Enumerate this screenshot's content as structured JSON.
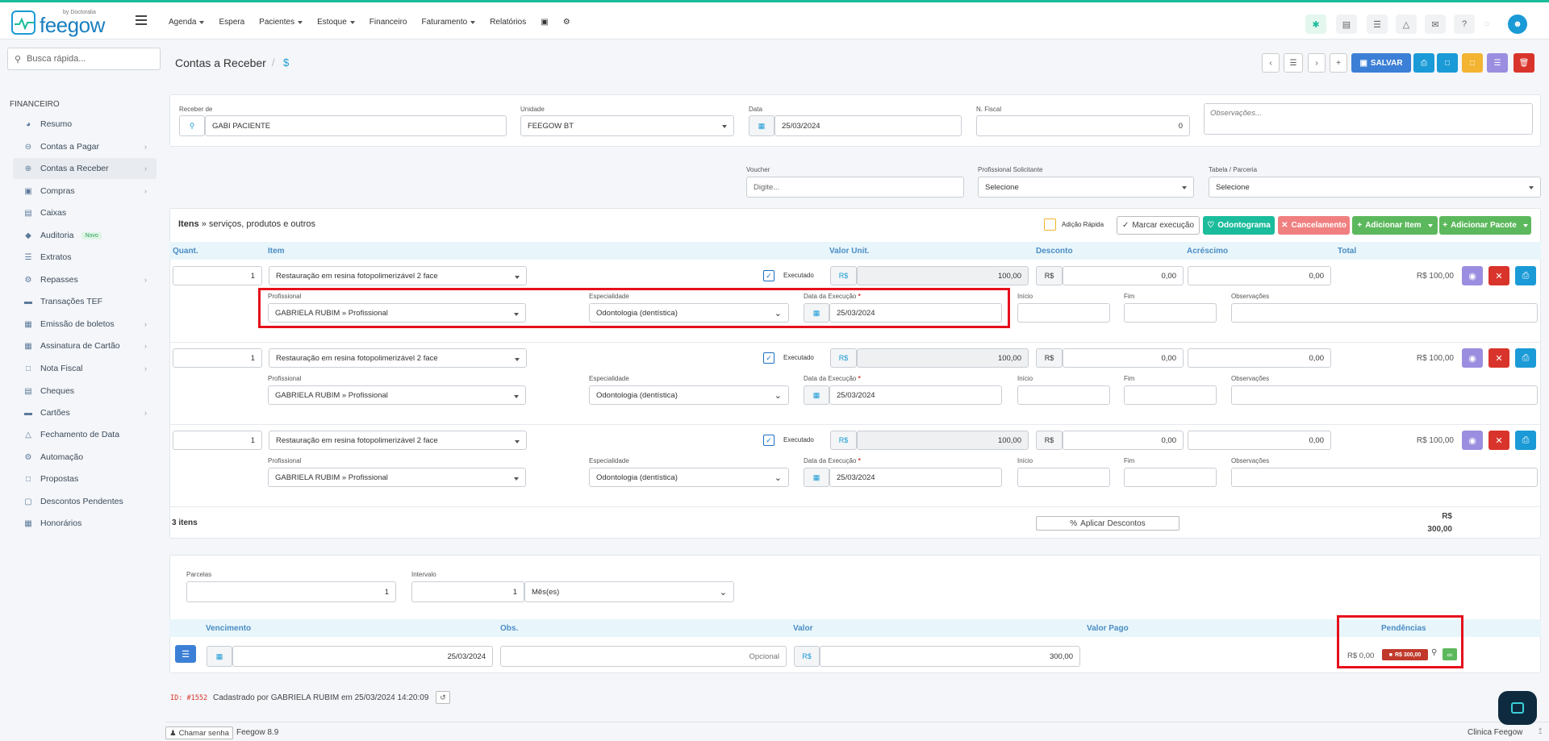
{
  "app": {
    "brand": "feegow",
    "brand_sub": "by Doctoralia"
  },
  "topnav": {
    "items": [
      {
        "label": "Agenda",
        "dropdown": true
      },
      {
        "label": "Espera",
        "dropdown": false
      },
      {
        "label": "Pacientes",
        "dropdown": true
      },
      {
        "label": "Estoque",
        "dropdown": true
      },
      {
        "label": "Financeiro",
        "dropdown": false
      },
      {
        "label": "Faturamento",
        "dropdown": true
      },
      {
        "label": "Relatórios",
        "dropdown": false
      }
    ]
  },
  "sidebar": {
    "search_placeholder": "Busca rápida...",
    "section_title": "FINANCEIRO",
    "new_badge": "Novo",
    "items": [
      {
        "label": "Resumo",
        "icon": "chart-icon"
      },
      {
        "label": "Contas a Pagar",
        "icon": "minus-circle-icon"
      },
      {
        "label": "Contas a Receber",
        "icon": "plus-circle-icon"
      },
      {
        "label": "Compras",
        "icon": "cart-icon"
      },
      {
        "label": "Caixas",
        "icon": "inbox-icon"
      },
      {
        "label": "Auditoria",
        "icon": "shield-icon"
      },
      {
        "label": "Extratos",
        "icon": "list-icon"
      },
      {
        "label": "Repasses",
        "icon": "handshake-icon"
      },
      {
        "label": "Transações TEF",
        "icon": "credit-card-icon"
      },
      {
        "label": "Emissão de boletos",
        "icon": "barcode-icon"
      },
      {
        "label": "Assinatura de Cartão",
        "icon": "card-signature-icon"
      },
      {
        "label": "Nota Fiscal",
        "icon": "document-icon"
      },
      {
        "label": "Cheques",
        "icon": "cheque-icon"
      },
      {
        "label": "Cartões",
        "icon": "credit-card-icon"
      },
      {
        "label": "Fechamento de Data",
        "icon": "lock-icon"
      },
      {
        "label": "Automação",
        "icon": "robot-icon"
      },
      {
        "label": "Propostas",
        "icon": "file-icon"
      },
      {
        "label": "Descontos Pendentes",
        "icon": "discount-icon"
      },
      {
        "label": "Honorários",
        "icon": "calendar-icon"
      }
    ]
  },
  "page": {
    "title": "Contas a Receber",
    "sep": "/",
    "currency_icon": "$",
    "save_label": "SALVAR"
  },
  "header_form": {
    "receber_de_label": "Receber de",
    "receber_de_value": "GABI PACIENTE",
    "unidade_label": "Unidade",
    "unidade_value": "FEEGOW BT",
    "data_label": "Data",
    "data_value": "25/03/2024",
    "nfiscal_label": "N. Fiscal",
    "nfiscal_value": "0",
    "obs_placeholder": "Observações...",
    "voucher_label": "Voucher",
    "voucher_placeholder": "Digite...",
    "prof_sol_label": "Profissional Solicitante",
    "prof_sol_value": "Selecione",
    "tabela_label": "Tabela / Parceria",
    "tabela_value": "Selecione"
  },
  "items_section": {
    "title_bold": "Itens",
    "title_rest": " » serviços, produtos e outros",
    "adicao_rapida": "Adição Rápida",
    "buttons": {
      "marcar": "Marcar execução",
      "odontograma": "Odontograma",
      "cancelamento": "Cancelamento",
      "add_item": "Adicionar Item",
      "add_pacote": "Adicionar Pacote"
    },
    "columns": {
      "quant": "Quant.",
      "item": "Item",
      "valor_unit": "Valor Unit.",
      "desconto": "Desconto",
      "acrescimo": "Acréscimo",
      "total": "Total"
    },
    "sub_labels": {
      "profissional": "Profissional",
      "especialidade": "Especialidade",
      "data_execucao": "Data da Execução",
      "required": "*",
      "inicio": "Início",
      "fim": "Fim",
      "observacoes": "Observações"
    },
    "executado_label": "Executado",
    "currency": "R$",
    "rows": [
      {
        "quant": "1",
        "item": "Restauração em resina fotopolimerizável 2 face",
        "executado": true,
        "valor_unit": "100,00",
        "desconto": "0,00",
        "acrescimo": "0,00",
        "total": "R$ 100,00",
        "profissional": "GABRIELA RUBIM » Profissional",
        "especialidade": "Odontologia (dentística)",
        "data_execucao": "25/03/2024"
      },
      {
        "quant": "1",
        "item": "Restauração em resina fotopolimerizável 2 face",
        "executado": true,
        "valor_unit": "100,00",
        "desconto": "0,00",
        "acrescimo": "0,00",
        "total": "R$ 100,00",
        "profissional": "GABRIELA RUBIM » Profissional",
        "especialidade": "Odontologia (dentística)",
        "data_execucao": "25/03/2024"
      },
      {
        "quant": "1",
        "item": "Restauração em resina fotopolimerizável 2 face",
        "executado": true,
        "valor_unit": "100,00",
        "desconto": "0,00",
        "acrescimo": "0,00",
        "total": "R$ 100,00",
        "profissional": "GABRIELA RUBIM » Profissional",
        "especialidade": "Odontologia (dentística)",
        "data_execucao": "25/03/2024"
      }
    ],
    "footer": {
      "count": "3 itens",
      "aplicar_descontos": "Aplicar Descontos",
      "total_currency": "R$",
      "total_value": "300,00"
    }
  },
  "parcelas": {
    "parcelas_label": "Parcelas",
    "parcelas_value": "1",
    "intervalo_label": "Intervalo",
    "intervalo_value": "1",
    "unidade_value": "Mês(es)",
    "columns": {
      "vencimento": "Vencimento",
      "obs": "Obs.",
      "valor": "Valor",
      "valor_pago": "Valor Pago",
      "pendencias": "Pendências"
    },
    "row": {
      "vencimento": "25/03/2024",
      "obs_placeholder": "Opcional",
      "valor": "300,00",
      "valor_pago": "R$ 0,00",
      "pendencia_badge": "R$ 300,00"
    }
  },
  "audit": {
    "id_label": "ID: #1552",
    "text": "Cadastrado por GABRIELA RUBIM em 25/03/2024 14:20:09"
  },
  "footer": {
    "chamar_senha": "Chamar senha",
    "version": "Feegow 8.9",
    "clinic": "Clinica Feegow"
  },
  "colors": {
    "accent": "#1a9ad6",
    "green": "#5cb85c",
    "red": "#d9342b",
    "teal": "#1bbc9b",
    "highlight": "#e5101c"
  }
}
